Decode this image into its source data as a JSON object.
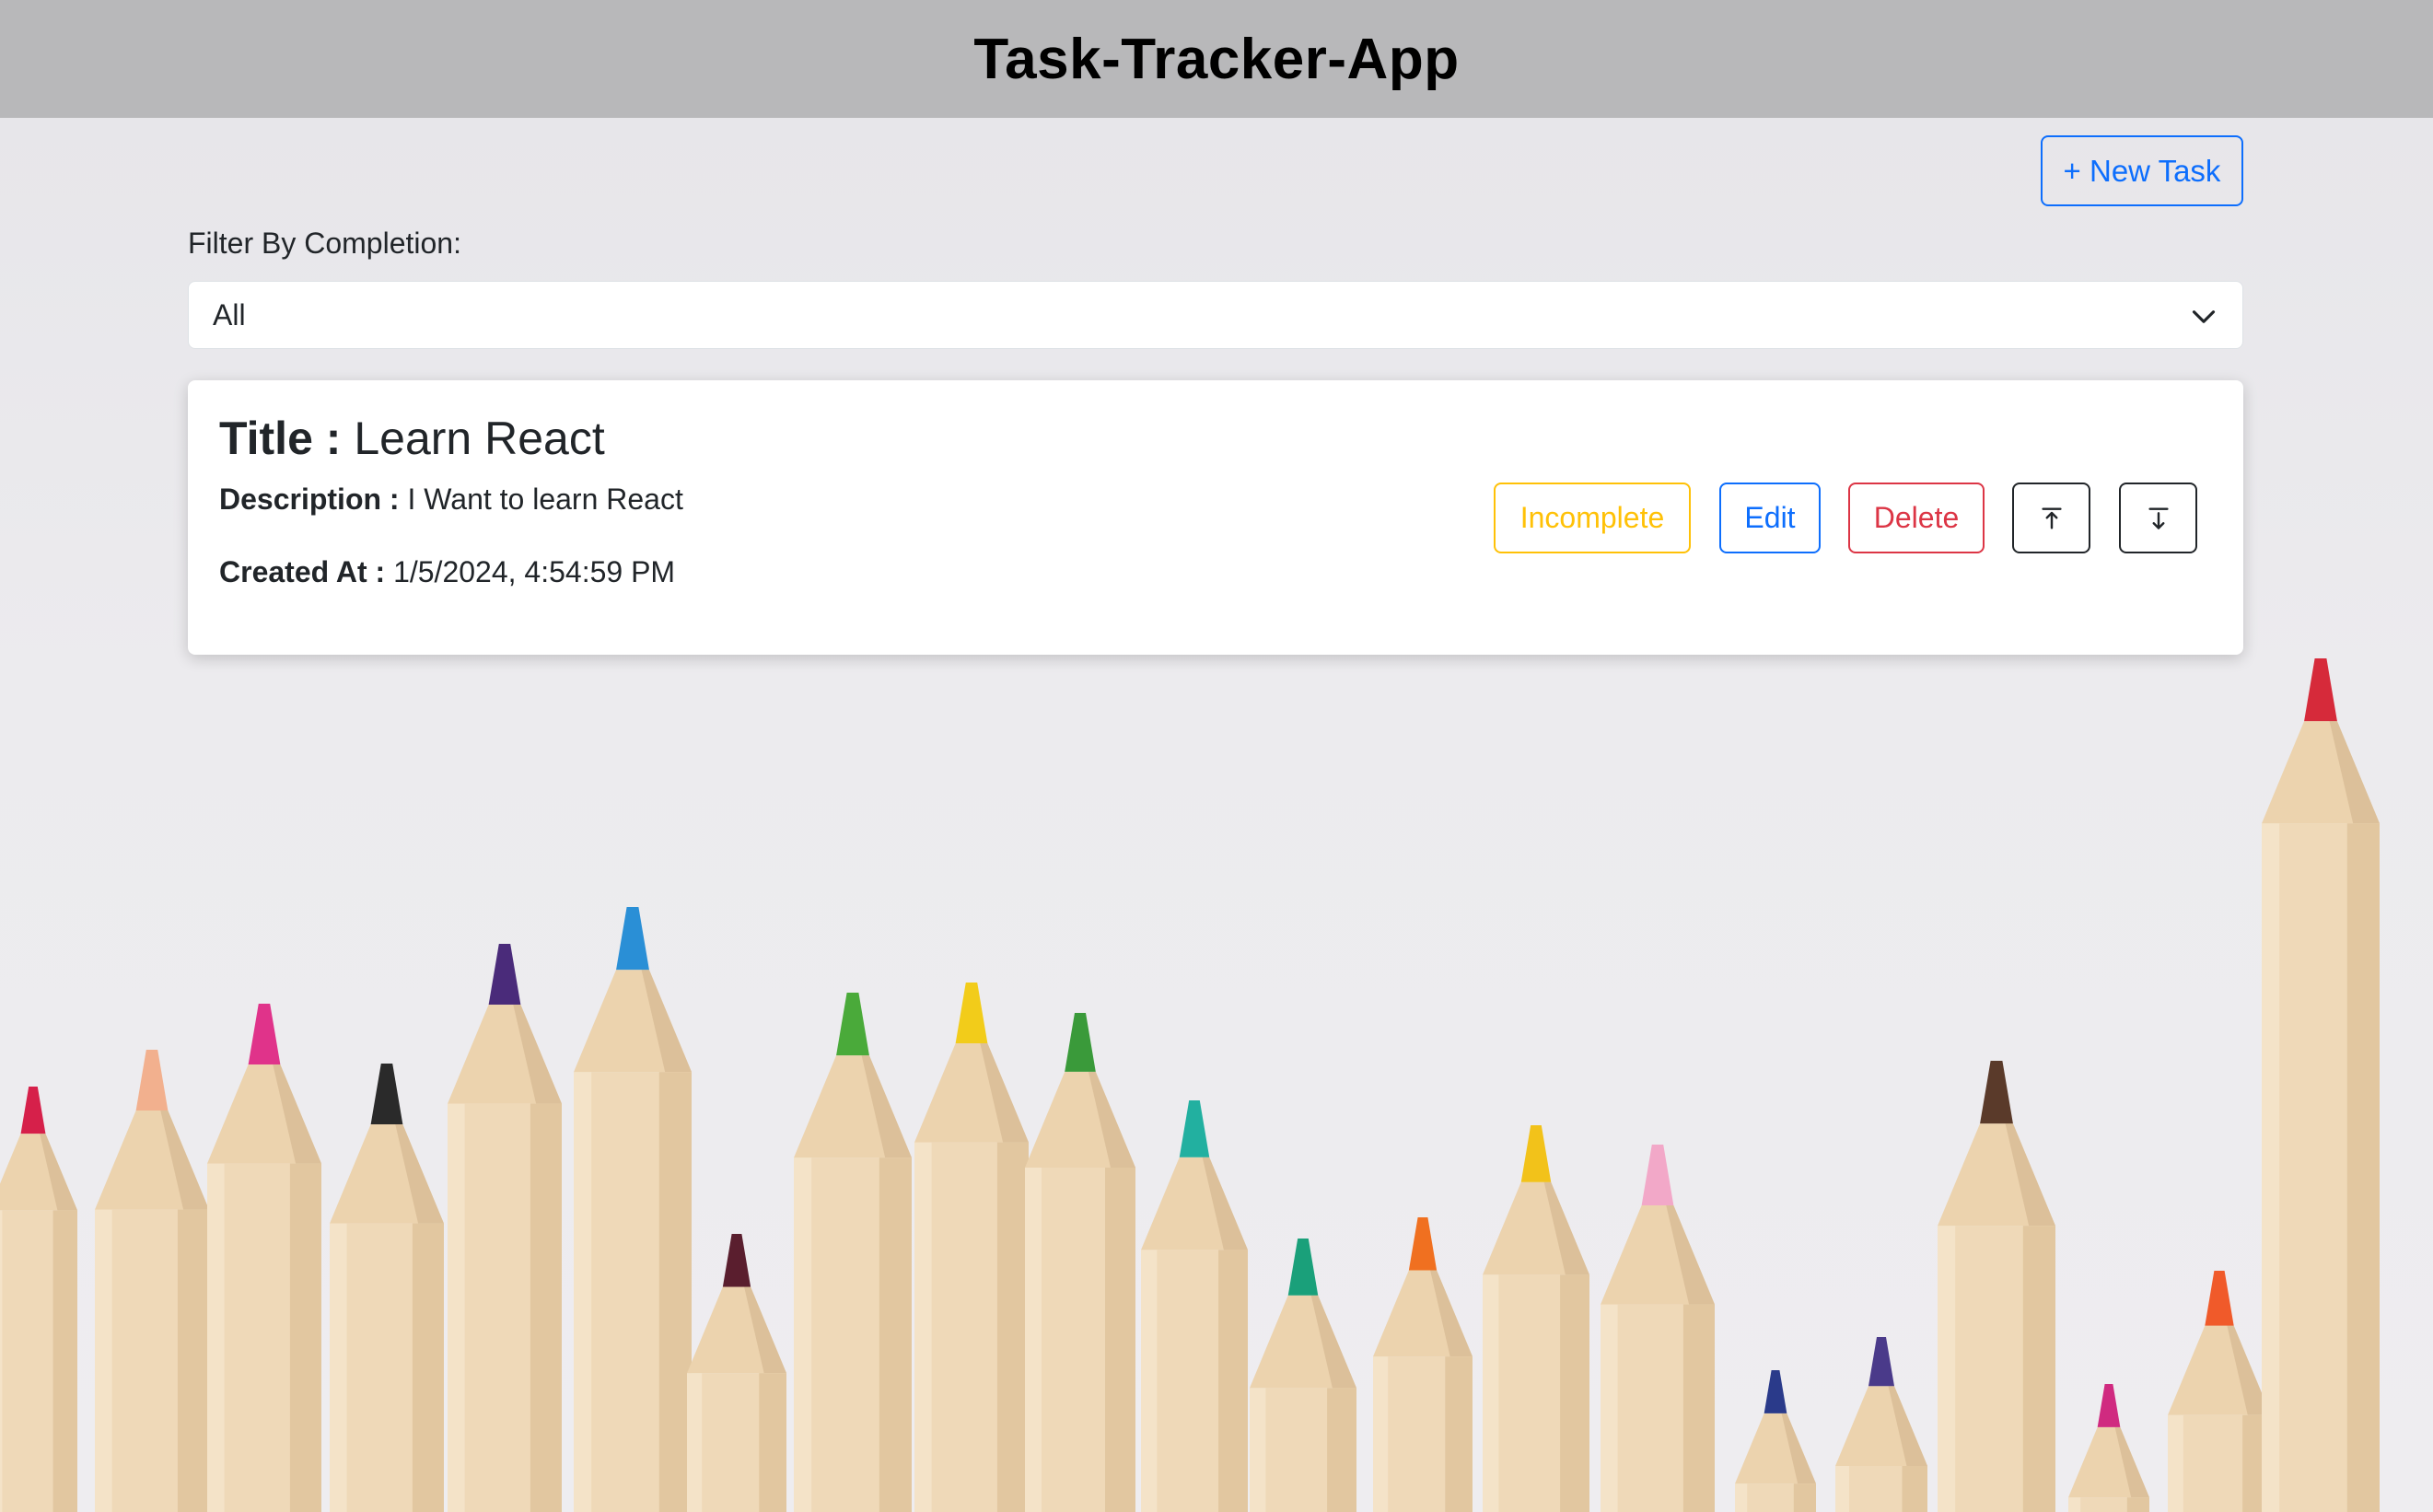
{
  "app": {
    "title": "Task-Tracker-App"
  },
  "toolbar": {
    "new_task_label": "+ New Task"
  },
  "filter": {
    "label": "Filter By Completion:",
    "selected": "All"
  },
  "tasks": [
    {
      "title_label": "Title :",
      "title": "Learn React",
      "description_label": "Description :",
      "description": "I Want to learn React",
      "created_label": "Created At :",
      "created_at": "1/5/2024, 4:54:59 PM",
      "actions": {
        "incomplete_label": "Incomplete",
        "edit_label": "Edit",
        "delete_label": "Delete",
        "move_up_icon": "arrow-up-to-line-icon",
        "move_down_icon": "arrow-down-to-line-icon"
      }
    }
  ],
  "colors": {
    "header_bg": "#b8b8ba",
    "primary": "#0d6efd",
    "warning": "#ffc107",
    "danger": "#dc3545",
    "dark": "#212529"
  }
}
